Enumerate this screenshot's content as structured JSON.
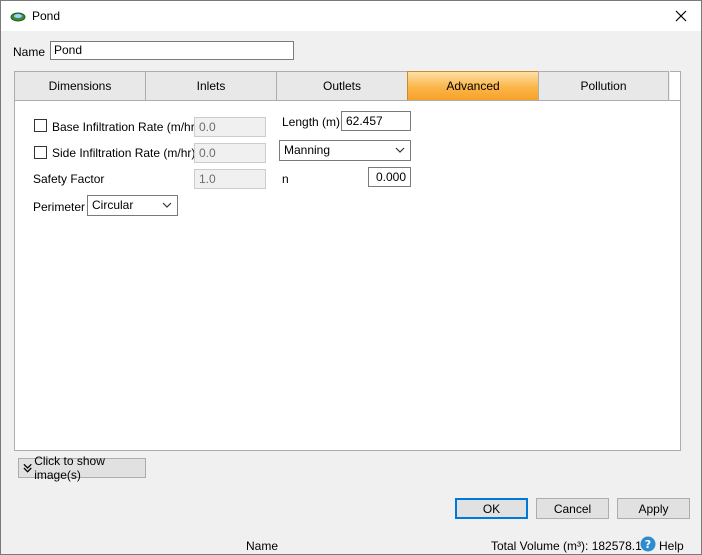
{
  "window": {
    "title": "Pond"
  },
  "name_field": {
    "label": "Name",
    "value": "Pond"
  },
  "tabs": [
    {
      "label": "Dimensions"
    },
    {
      "label": "Inlets"
    },
    {
      "label": "Outlets"
    },
    {
      "label": "Advanced"
    },
    {
      "label": "Pollution"
    }
  ],
  "active_tab": "Advanced",
  "advanced": {
    "base_infiltration": {
      "label": "Base Infiltration Rate (m/hr)",
      "value": "0.0"
    },
    "side_infiltration": {
      "label": "Side Infiltration Rate (m/hr)",
      "value": "0.0"
    },
    "safety_factor": {
      "label": "Safety Factor",
      "value": "1.0"
    },
    "perimeter": {
      "label": "Perimeter",
      "selected": "Circular"
    },
    "length": {
      "label": "Length (m)",
      "value": "62.457"
    },
    "roughness_method": {
      "selected": "Manning"
    },
    "n": {
      "label": "n",
      "value": "0.000"
    }
  },
  "show_images_label": "Click to show image(s)",
  "buttons": {
    "ok": "OK",
    "cancel": "Cancel",
    "apply": "Apply"
  },
  "status": {
    "name": "Name",
    "total_volume": "Total Volume (m³): 182578.157",
    "help": "Help"
  },
  "colors": {
    "active_tab": "#fbb548",
    "default_button_border": "#0078d7",
    "help_icon": "#2e8bd0"
  }
}
